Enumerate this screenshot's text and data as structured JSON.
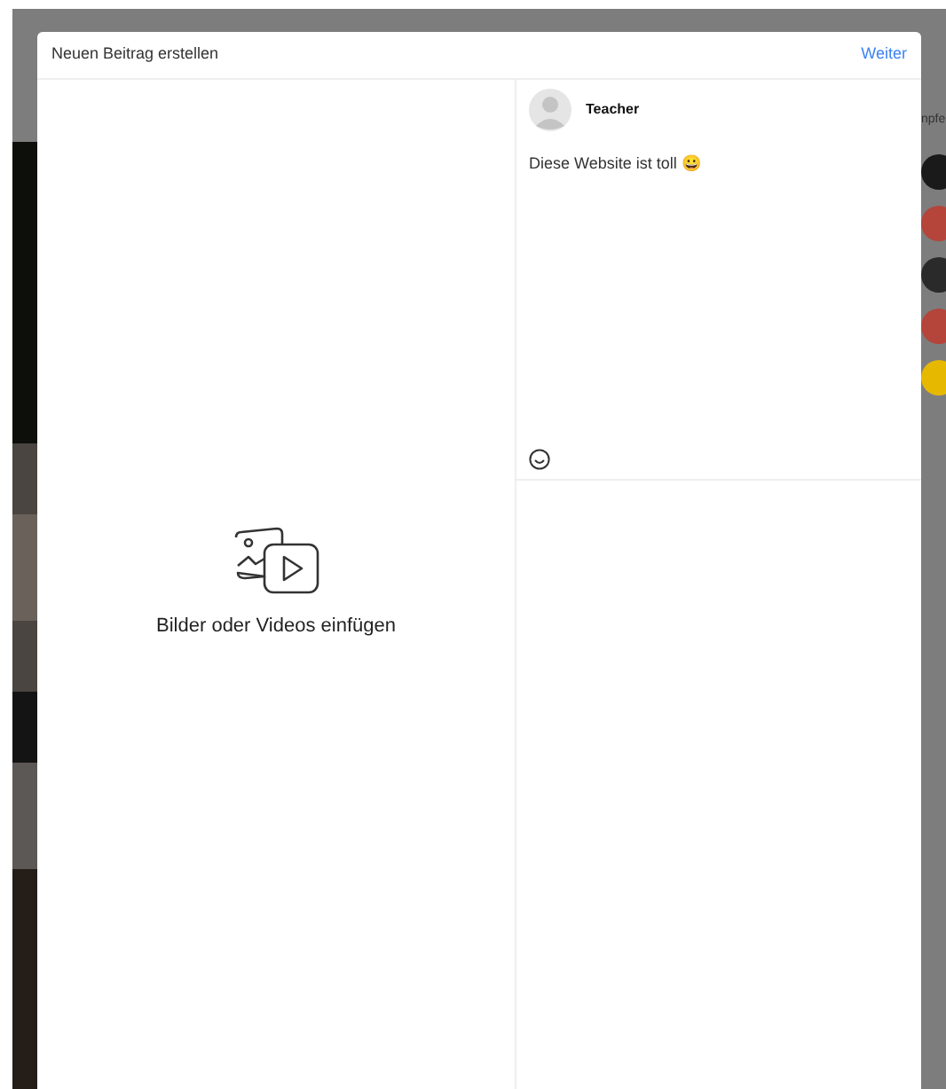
{
  "background": {
    "side_heading": "npfe",
    "avatars": [
      {
        "color": "#1a1a1a"
      },
      {
        "color": "#b5443a"
      },
      {
        "color": "#2a2a2a"
      },
      {
        "color": "#b5443a"
      },
      {
        "color": "#e6b800"
      }
    ]
  },
  "dialog": {
    "title": "Neuen Beitrag erstellen",
    "next_button": "Weiter",
    "media_upload": {
      "label": "Bilder oder Videos einfügen"
    },
    "author": {
      "name": "Teacher"
    },
    "caption": {
      "value": "Diese Website ist toll 😀"
    }
  }
}
